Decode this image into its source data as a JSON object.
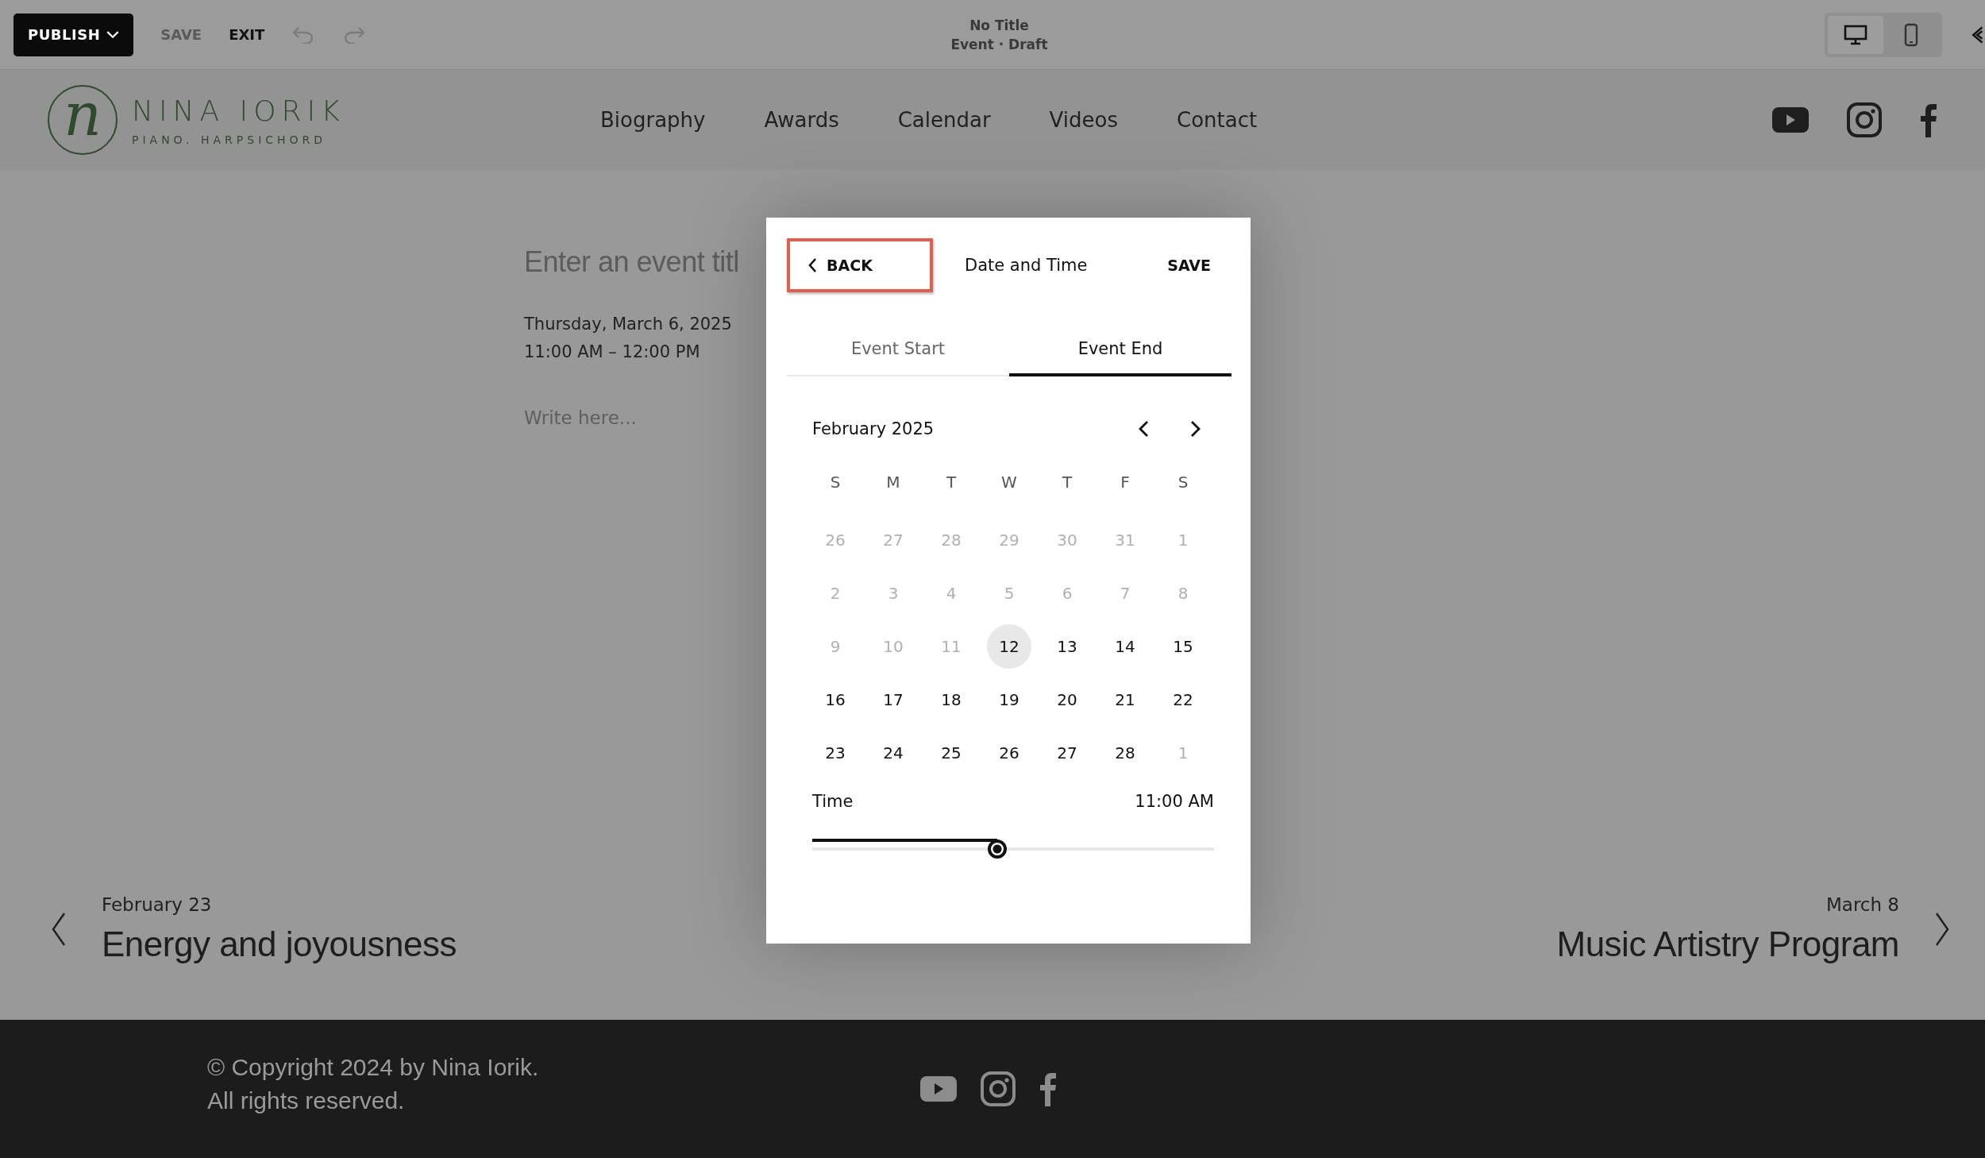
{
  "toolbar": {
    "publish": "PUBLISH",
    "save": {
      "label": "SAVE",
      "disabled": true
    },
    "exit": "EXIT",
    "undo_disabled": true,
    "redo_disabled": true,
    "title": "No Title",
    "subtitle": "Event · Draft",
    "views": [
      {
        "kind": "desktop",
        "selected": true
      },
      {
        "kind": "mobile",
        "selected": false
      }
    ]
  },
  "header": {
    "logo": {
      "monogram": "n",
      "name": "NINA IORIK",
      "tagline": "PIANO. HARPSICHORD"
    },
    "nav": [
      "Biography",
      "Awards",
      "Calendar",
      "Videos",
      "Contact"
    ],
    "social": [
      {
        "kind": "youtube"
      },
      {
        "kind": "instagram"
      },
      {
        "kind": "facebook"
      }
    ]
  },
  "event": {
    "title_placeholder": "Enter an event titl",
    "date": "Thursday, March 6, 2025",
    "time": "11:00 AM – 12:00 PM",
    "body_placeholder": "Write here..."
  },
  "pager": {
    "previous": {
      "date": "February 23",
      "title": "Energy and joyousness"
    },
    "next": {
      "date": "March 8",
      "title": "Music Artistry Program"
    }
  },
  "footer": {
    "lines": [
      "© Copyright 2024 by Nina Iorik.",
      "All rights reserved."
    ],
    "social": [
      {
        "kind": "youtube"
      },
      {
        "kind": "instagram"
      },
      {
        "kind": "facebook"
      }
    ]
  },
  "dialog": {
    "back": {
      "label": "BACK",
      "highlighted": true
    },
    "title": "Date and Time",
    "save": "SAVE",
    "tabs": [
      {
        "label": "Event Start",
        "selected": false
      },
      {
        "label": "Event End",
        "selected": true
      }
    ],
    "month": "February 2025",
    "weekdays": [
      "S",
      "M",
      "T",
      "W",
      "T",
      "F",
      "S"
    ],
    "days": [
      {
        "label": "26",
        "muted": true,
        "selected": false
      },
      {
        "label": "27",
        "muted": true,
        "selected": false
      },
      {
        "label": "28",
        "muted": true,
        "selected": false
      },
      {
        "label": "29",
        "muted": true,
        "selected": false
      },
      {
        "label": "30",
        "muted": true,
        "selected": false
      },
      {
        "label": "31",
        "muted": true,
        "selected": false
      },
      {
        "label": "1",
        "muted": true,
        "selected": false
      },
      {
        "label": "2",
        "muted": true,
        "selected": false
      },
      {
        "label": "3",
        "muted": true,
        "selected": false
      },
      {
        "label": "4",
        "muted": true,
        "selected": false
      },
      {
        "label": "5",
        "muted": true,
        "selected": false
      },
      {
        "label": "6",
        "muted": true,
        "selected": false
      },
      {
        "label": "7",
        "muted": true,
        "selected": false
      },
      {
        "label": "8",
        "muted": true,
        "selected": false
      },
      {
        "label": "9",
        "muted": true,
        "selected": false
      },
      {
        "label": "10",
        "muted": true,
        "selected": false
      },
      {
        "label": "11",
        "muted": true,
        "selected": false
      },
      {
        "label": "12",
        "muted": false,
        "selected": true
      },
      {
        "label": "13",
        "muted": false,
        "selected": false
      },
      {
        "label": "14",
        "muted": false,
        "selected": false
      },
      {
        "label": "15",
        "muted": false,
        "selected": false
      },
      {
        "label": "16",
        "muted": false,
        "selected": false
      },
      {
        "label": "17",
        "muted": false,
        "selected": false
      },
      {
        "label": "18",
        "muted": false,
        "selected": false
      },
      {
        "label": "19",
        "muted": false,
        "selected": false
      },
      {
        "label": "20",
        "muted": false,
        "selected": false
      },
      {
        "label": "21",
        "muted": false,
        "selected": false
      },
      {
        "label": "22",
        "muted": false,
        "selected": false
      },
      {
        "label": "23",
        "muted": false,
        "selected": false
      },
      {
        "label": "24",
        "muted": false,
        "selected": false
      },
      {
        "label": "25",
        "muted": false,
        "selected": false
      },
      {
        "label": "26",
        "muted": false,
        "selected": false
      },
      {
        "label": "27",
        "muted": false,
        "selected": false
      },
      {
        "label": "28",
        "muted": false,
        "selected": false
      },
      {
        "label": "1",
        "muted": true,
        "selected": false
      }
    ],
    "time_label": "Time",
    "time_value": "11:00 AM",
    "time_slider": {
      "level": 0.46
    }
  }
}
